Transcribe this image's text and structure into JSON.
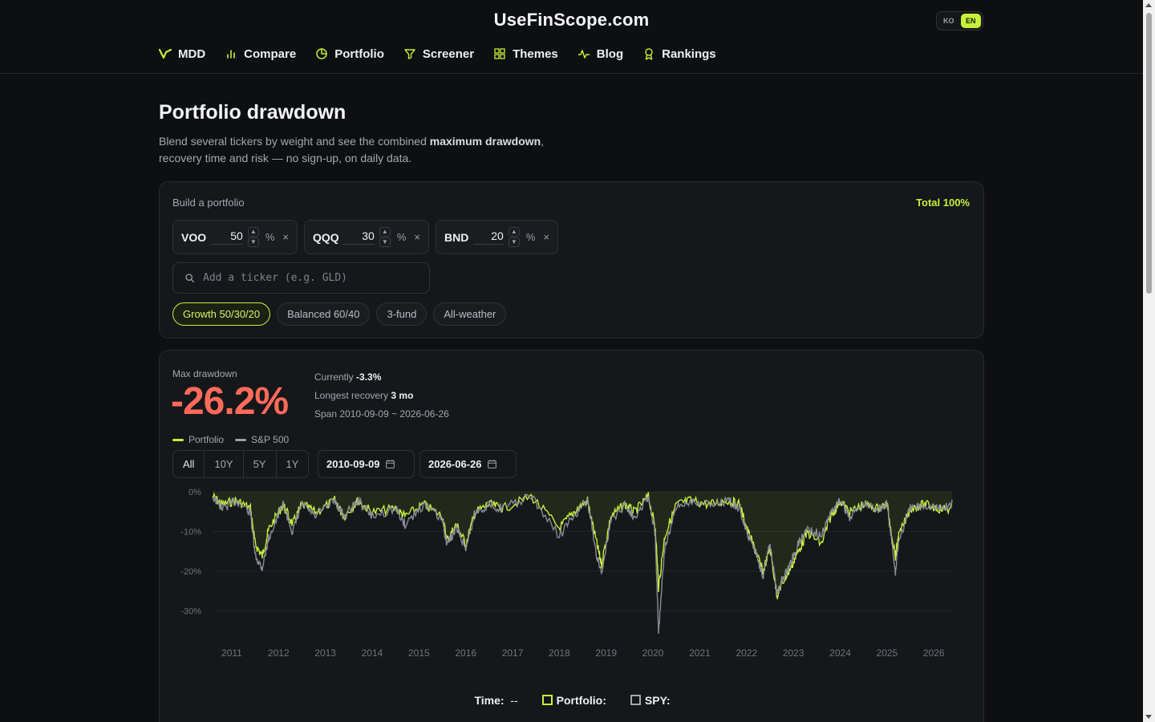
{
  "site": {
    "title": "UseFinScope.com",
    "lang_ko": "KO",
    "lang_en": "EN"
  },
  "nav": [
    {
      "label": "MDD",
      "icon": "mdd-logo-icon"
    },
    {
      "label": "Compare",
      "icon": "bar-chart-icon"
    },
    {
      "label": "Portfolio",
      "icon": "pie-chart-icon"
    },
    {
      "label": "Screener",
      "icon": "filter-icon"
    },
    {
      "label": "Themes",
      "icon": "grid-icon"
    },
    {
      "label": "Blog",
      "icon": "activity-icon"
    },
    {
      "label": "Rankings",
      "icon": "award-icon"
    }
  ],
  "page": {
    "title": "Portfolio drawdown",
    "subtitle_pre": "Blend several tickers by weight and see the combined ",
    "subtitle_bold": "maximum drawdown",
    "subtitle_post": ", recovery time and risk — no sign-up, on daily data."
  },
  "builder": {
    "label": "Build a portfolio",
    "total": "Total 100%",
    "holdings": [
      {
        "ticker": "VOO",
        "weight": "50"
      },
      {
        "ticker": "QQQ",
        "weight": "30"
      },
      {
        "ticker": "BND",
        "weight": "20"
      }
    ],
    "pct_symbol": "%",
    "remove_symbol": "×",
    "search_placeholder": "Add a ticker (e.g. GLD)",
    "presets": [
      "Growth 50/30/20",
      "Balanced 60/40",
      "3-fund",
      "All-weather"
    ]
  },
  "results": {
    "mdd_label": "Max drawdown",
    "mdd_value": "-26.2%",
    "currently_label": "Currently",
    "currently_value": "-3.3%",
    "recovery_label": "Longest recovery",
    "recovery_value": "3 mo",
    "span_label": "Span",
    "span_value": "2010-09-09 ~ 2026-06-26",
    "legend_portfolio": "Portfolio",
    "legend_sp500": "S&P 500",
    "range_tabs": [
      "All",
      "10Y",
      "5Y",
      "1Y"
    ],
    "start_date": "2010-09-09",
    "end_date": "2026-06-26",
    "readout_time_label": "Time:",
    "readout_time_value": "--",
    "readout_portfolio_label": "Portfolio:",
    "readout_spy_label": "SPY:"
  },
  "colors": {
    "accent": "#c6f03a",
    "negative": "#ff6b5a",
    "benchmark": "#9aa0a8"
  },
  "chart_data": {
    "type": "area",
    "ylim": [
      -35,
      0
    ],
    "y_ticks": [
      "0%",
      "-10%",
      "-20%",
      "-30%"
    ],
    "y_tick_values": [
      0,
      -10,
      -20,
      -30
    ],
    "x_ticks": [
      "2011",
      "2012",
      "2013",
      "2014",
      "2015",
      "2016",
      "2017",
      "2018",
      "2019",
      "2020",
      "2021",
      "2022",
      "2023",
      "2024",
      "2025",
      "2026"
    ],
    "x_range": [
      2010.69,
      2026.49
    ],
    "series": [
      {
        "name": "Portfolio",
        "points": [
          [
            2010.69,
            0
          ],
          [
            2010.9,
            -2
          ],
          [
            2011.2,
            -1
          ],
          [
            2011.5,
            -3
          ],
          [
            2011.6,
            -12
          ],
          [
            2011.75,
            -15
          ],
          [
            2011.9,
            -8
          ],
          [
            2012.2,
            -2
          ],
          [
            2012.4,
            -7
          ],
          [
            2012.6,
            -2
          ],
          [
            2012.9,
            -4
          ],
          [
            2013.3,
            -1
          ],
          [
            2013.5,
            -5
          ],
          [
            2013.8,
            -1
          ],
          [
            2014.1,
            -4
          ],
          [
            2014.6,
            -3
          ],
          [
            2014.8,
            -5
          ],
          [
            2015.2,
            -2
          ],
          [
            2015.6,
            -5
          ],
          [
            2015.7,
            -11
          ],
          [
            2015.9,
            -7
          ],
          [
            2016.1,
            -12
          ],
          [
            2016.3,
            -4
          ],
          [
            2016.6,
            -2
          ],
          [
            2016.9,
            -3
          ],
          [
            2017.5,
            0
          ],
          [
            2018.1,
            -8
          ],
          [
            2018.4,
            -4
          ],
          [
            2018.7,
            -1
          ],
          [
            2018.9,
            -12
          ],
          [
            2019.0,
            -17
          ],
          [
            2019.2,
            -5
          ],
          [
            2019.5,
            -2
          ],
          [
            2019.7,
            -4
          ],
          [
            2020.0,
            0
          ],
          [
            2020.15,
            -8
          ],
          [
            2020.22,
            -23
          ],
          [
            2020.35,
            -10
          ],
          [
            2020.6,
            -2
          ],
          [
            2020.9,
            -1
          ],
          [
            2021.3,
            -2
          ],
          [
            2021.7,
            -1
          ],
          [
            2021.95,
            -2
          ],
          [
            2022.1,
            -8
          ],
          [
            2022.3,
            -14
          ],
          [
            2022.45,
            -19
          ],
          [
            2022.6,
            -13
          ],
          [
            2022.75,
            -25
          ],
          [
            2022.85,
            -22
          ],
          [
            2023.0,
            -19
          ],
          [
            2023.2,
            -14
          ],
          [
            2023.4,
            -9
          ],
          [
            2023.7,
            -12
          ],
          [
            2023.9,
            -5
          ],
          [
            2024.1,
            -1
          ],
          [
            2024.3,
            -4
          ],
          [
            2024.6,
            -2
          ],
          [
            2024.9,
            -3
          ],
          [
            2025.1,
            -2
          ],
          [
            2025.28,
            -15
          ],
          [
            2025.35,
            -10
          ],
          [
            2025.6,
            -3
          ],
          [
            2025.9,
            -2
          ],
          [
            2026.2,
            -3
          ],
          [
            2026.49,
            -3.3
          ]
        ]
      },
      {
        "name": "S&P 500",
        "points": [
          [
            2010.69,
            0
          ],
          [
            2010.9,
            -3
          ],
          [
            2011.2,
            -1
          ],
          [
            2011.5,
            -4
          ],
          [
            2011.6,
            -15
          ],
          [
            2011.75,
            -18
          ],
          [
            2011.9,
            -10
          ],
          [
            2012.2,
            -2
          ],
          [
            2012.4,
            -9
          ],
          [
            2012.6,
            -2
          ],
          [
            2012.9,
            -5
          ],
          [
            2013.3,
            -1
          ],
          [
            2013.5,
            -5
          ],
          [
            2013.8,
            -1
          ],
          [
            2014.1,
            -5
          ],
          [
            2014.6,
            -3
          ],
          [
            2014.8,
            -7
          ],
          [
            2015.2,
            -2
          ],
          [
            2015.6,
            -6
          ],
          [
            2015.7,
            -12
          ],
          [
            2015.9,
            -8
          ],
          [
            2016.1,
            -13
          ],
          [
            2016.3,
            -4
          ],
          [
            2016.6,
            -2
          ],
          [
            2016.9,
            -3
          ],
          [
            2017.5,
            0
          ],
          [
            2018.1,
            -10
          ],
          [
            2018.4,
            -5
          ],
          [
            2018.7,
            -1
          ],
          [
            2018.9,
            -15
          ],
          [
            2019.0,
            -19
          ],
          [
            2019.2,
            -6
          ],
          [
            2019.5,
            -2
          ],
          [
            2019.7,
            -5
          ],
          [
            2020.0,
            0
          ],
          [
            2020.15,
            -10
          ],
          [
            2020.22,
            -34
          ],
          [
            2020.35,
            -13
          ],
          [
            2020.6,
            -3
          ],
          [
            2020.9,
            -1
          ],
          [
            2021.3,
            -2
          ],
          [
            2021.7,
            -1
          ],
          [
            2021.95,
            -3
          ],
          [
            2022.1,
            -9
          ],
          [
            2022.3,
            -14
          ],
          [
            2022.45,
            -20
          ],
          [
            2022.6,
            -12
          ],
          [
            2022.75,
            -25
          ],
          [
            2022.85,
            -21
          ],
          [
            2023.0,
            -18
          ],
          [
            2023.2,
            -12
          ],
          [
            2023.4,
            -8
          ],
          [
            2023.7,
            -10
          ],
          [
            2023.9,
            -4
          ],
          [
            2024.1,
            -1
          ],
          [
            2024.3,
            -5
          ],
          [
            2024.6,
            -2
          ],
          [
            2024.9,
            -3
          ],
          [
            2025.1,
            -2
          ],
          [
            2025.28,
            -19
          ],
          [
            2025.35,
            -11
          ],
          [
            2025.6,
            -3
          ],
          [
            2025.9,
            -2
          ],
          [
            2026.2,
            -3
          ],
          [
            2026.49,
            -2
          ]
        ]
      }
    ]
  }
}
